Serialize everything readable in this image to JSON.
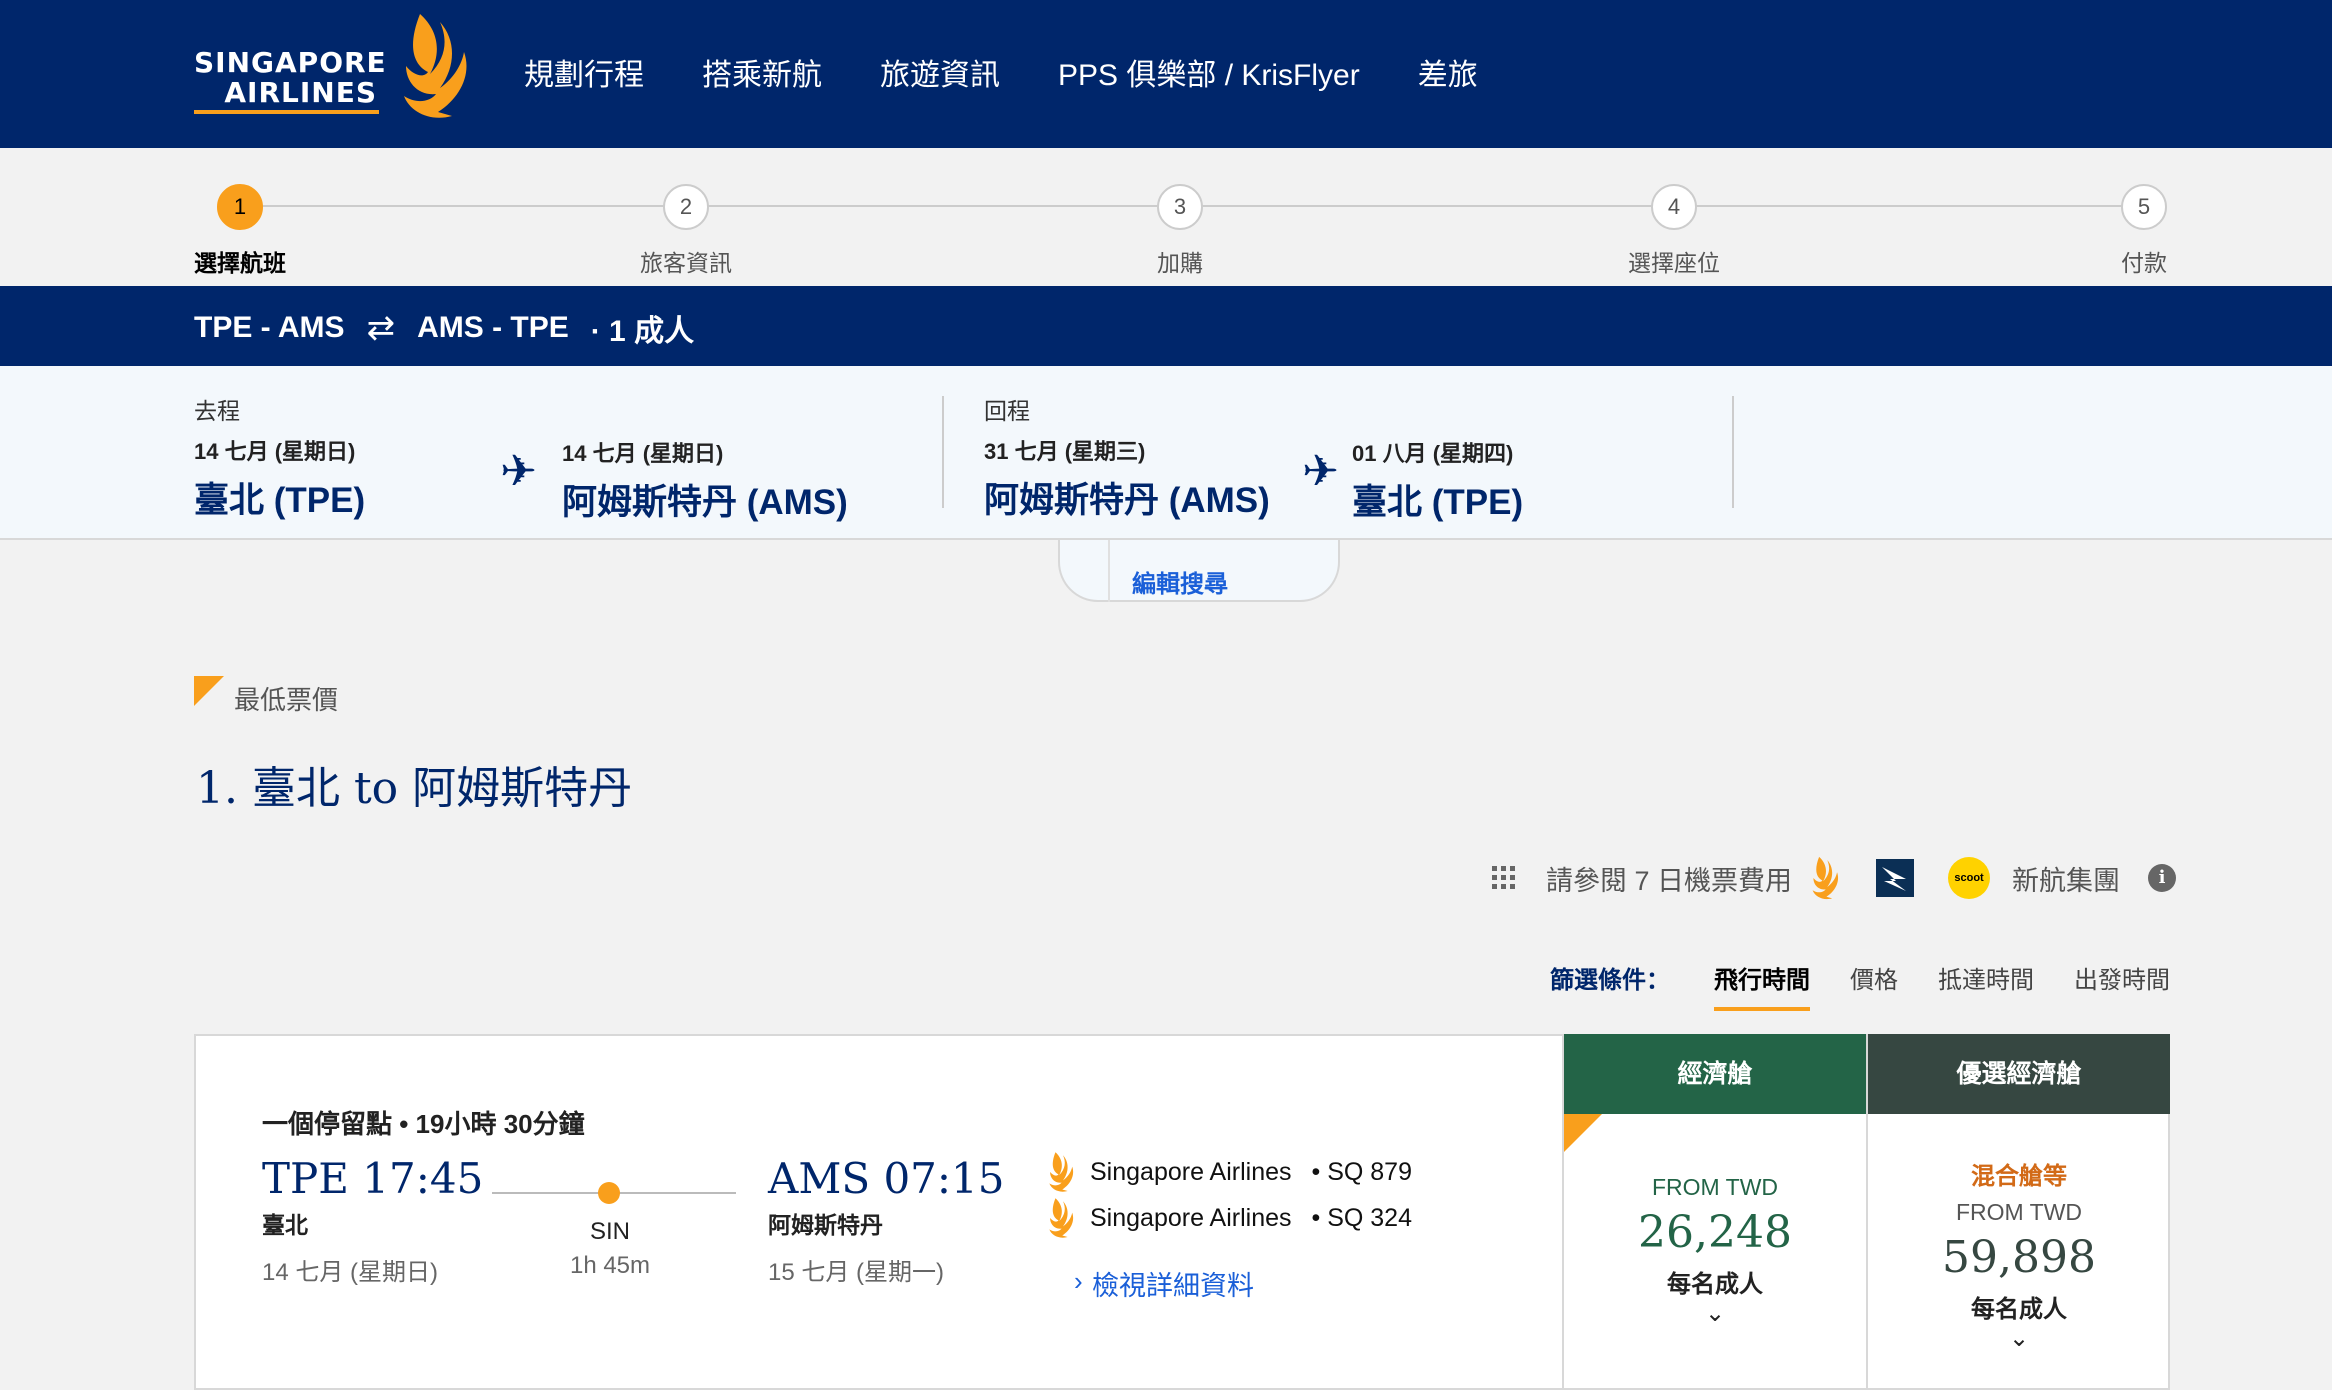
{
  "header": {
    "logo_line1": "SINGAPORE",
    "logo_line2": "AIRLINES",
    "nav": [
      "規劃行程",
      "搭乘新航",
      "旅遊資訊",
      "PPS 俱樂部 / KrisFlyer",
      "差旅"
    ]
  },
  "steps": [
    {
      "num": "1",
      "label": "選擇航班",
      "active": true
    },
    {
      "num": "2",
      "label": "旅客資訊"
    },
    {
      "num": "3",
      "label": "加購"
    },
    {
      "num": "4",
      "label": "選擇座位"
    },
    {
      "num": "5",
      "label": "付款"
    }
  ],
  "route": {
    "outbound": "TPE - AMS",
    "swap": "⇄",
    "inbound": "AMS - TPE",
    "passengers": "· 1 成人"
  },
  "trip": {
    "outbound": {
      "kind": "去程",
      "dep_date": "14 七月 (星期日)",
      "dep_city": "臺北 (TPE)",
      "arr_date": "14 七月 (星期日)",
      "arr_city": "阿姆斯特丹 (AMS)"
    },
    "return": {
      "kind": "回程",
      "dep_date": "31 七月 (星期三)",
      "dep_city": "阿姆斯特丹 (AMS)",
      "arr_date": "01 八月 (星期四)",
      "arr_city": "臺北 (TPE)"
    },
    "edit_label": "編輯搜尋"
  },
  "results": {
    "lowest_label": "最低票價",
    "title": "1. 臺北 to 阿姆斯特丹",
    "seven_day_label": "請參閱 7 日機票費用",
    "group_label": "新航集團",
    "sort_label": "篩選條件：",
    "sort_options": [
      "飛行時間",
      "價格",
      "抵達時間",
      "出發時間"
    ],
    "active_sort": "飛行時間"
  },
  "flight": {
    "stops": "一個停留點 • 19小時 30分鐘",
    "dep_time": "TPE 17:45",
    "dep_city": "臺北",
    "dep_date": "14 七月 (星期日)",
    "stop_code": "SIN",
    "stop_duration": "1h 45m",
    "arr_time": "AMS 07:15",
    "arr_city": "阿姆斯特丹",
    "arr_date": "15 七月 (星期一)",
    "carriers": [
      {
        "name": "Singapore Airlines",
        "flight": "• SQ 879"
      },
      {
        "name": "Singapore Airlines",
        "flight": "• SQ 324"
      }
    ],
    "details_chevron": "›",
    "details_label": "檢視詳細資料"
  },
  "fares": {
    "economy": {
      "header": "經濟艙",
      "from": "FROM TWD",
      "price": "26,248",
      "per": "每名成人",
      "chevron": "⌄"
    },
    "premium": {
      "header": "優選經濟艙",
      "mixed": "混合艙等",
      "from": "FROM TWD",
      "price": "59,898",
      "per": "每名成人",
      "chevron": "⌄"
    }
  },
  "colors": {
    "navy": "#00266b",
    "gold": "#f99f1c",
    "economy_green": "#236447",
    "premium_dark": "#364741",
    "link_blue": "#1a5fd8"
  }
}
